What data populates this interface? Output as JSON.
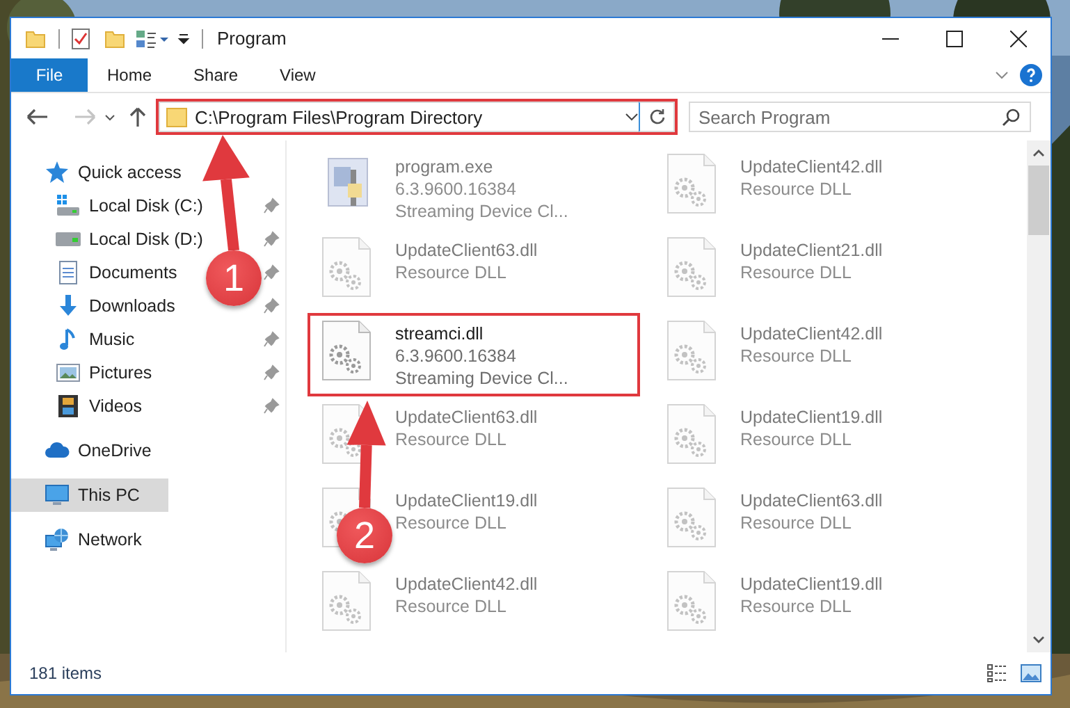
{
  "window": {
    "title": "Program"
  },
  "ribbon": {
    "tabs": [
      {
        "label": "File",
        "kind": "menu"
      },
      {
        "label": "Home",
        "kind": "tab"
      },
      {
        "label": "Share",
        "kind": "tab"
      },
      {
        "label": "View",
        "kind": "tab"
      }
    ]
  },
  "navigation": {
    "back": {
      "disabled": false
    },
    "forward": {
      "disabled": true
    }
  },
  "address": {
    "path": "C:\\Program Files\\Program Directory",
    "highlighted": true
  },
  "search": {
    "placeholder": "Search Program"
  },
  "sidebar": {
    "items": [
      {
        "label": "Quick access",
        "kind": "star",
        "selected": false,
        "children": [
          {
            "label": "Local Disk (C:)",
            "kind": "drive_c",
            "pinned": true,
            "selected": false
          },
          {
            "label": "Local Disk (D:)",
            "kind": "drive",
            "pinned": true,
            "selected": false
          },
          {
            "label": "Documents",
            "kind": "documents",
            "pinned": true,
            "selected": false
          },
          {
            "label": "Downloads",
            "kind": "downloads",
            "pinned": true,
            "selected": false
          },
          {
            "label": "Music",
            "kind": "music",
            "pinned": true,
            "selected": false
          },
          {
            "label": "Pictures",
            "kind": "pictures",
            "pinned": true,
            "selected": false
          },
          {
            "label": "Videos",
            "kind": "videos",
            "pinned": true,
            "selected": false
          }
        ]
      },
      {
        "label": "OneDrive",
        "kind": "cloud",
        "selected": false
      },
      {
        "label": "This PC",
        "kind": "pc",
        "selected": true
      },
      {
        "label": "Network",
        "kind": "network",
        "selected": false
      }
    ]
  },
  "files": [
    {
      "name": "program.exe",
      "kind": "exe",
      "lines": [
        "6.3.9600.16384",
        "Streaming Device Cl..."
      ],
      "blurred": true,
      "highlighted": false
    },
    {
      "name": "UpdateClient42.dll",
      "kind": "dll",
      "lines": [
        "Resource DLL"
      ],
      "blurred": true,
      "highlighted": false
    },
    {
      "name": "UpdateClient63.dll",
      "kind": "dll",
      "lines": [
        "Resource DLL"
      ],
      "blurred": true,
      "highlighted": false
    },
    {
      "name": "UpdateClient21.dll",
      "kind": "dll",
      "lines": [
        "Resource DLL"
      ],
      "blurred": true,
      "highlighted": false
    },
    {
      "name": "streamci.dll",
      "kind": "dll",
      "lines": [
        "6.3.9600.16384",
        "Streaming Device Cl..."
      ],
      "blurred": false,
      "highlighted": true
    },
    {
      "name": "UpdateClient42.dll",
      "kind": "dll",
      "lines": [
        "Resource DLL"
      ],
      "blurred": true,
      "highlighted": false
    },
    {
      "name": "UpdateClient63.dll",
      "kind": "dll",
      "lines": [
        "Resource DLL"
      ],
      "blurred": true,
      "highlighted": false
    },
    {
      "name": "UpdateClient19.dll",
      "kind": "dll",
      "lines": [
        "Resource DLL"
      ],
      "blurred": true,
      "highlighted": false
    },
    {
      "name": "UpdateClient19.dll",
      "kind": "dll",
      "lines": [
        "Resource DLL"
      ],
      "blurred": true,
      "highlighted": false
    },
    {
      "name": "UpdateClient63.dll",
      "kind": "dll",
      "lines": [
        "Resource DLL"
      ],
      "blurred": true,
      "highlighted": false
    },
    {
      "name": "UpdateClient42.dll",
      "kind": "dll",
      "lines": [
        "Resource DLL"
      ],
      "blurred": true,
      "highlighted": false
    },
    {
      "name": "UpdateClient19.dll",
      "kind": "dll",
      "lines": [
        "Resource DLL"
      ],
      "blurred": true,
      "highlighted": false
    }
  ],
  "status_bar": {
    "item_count": "181 items"
  },
  "annotations": [
    {
      "label": "1",
      "kind": "address"
    },
    {
      "label": "2",
      "kind": "file"
    }
  ]
}
